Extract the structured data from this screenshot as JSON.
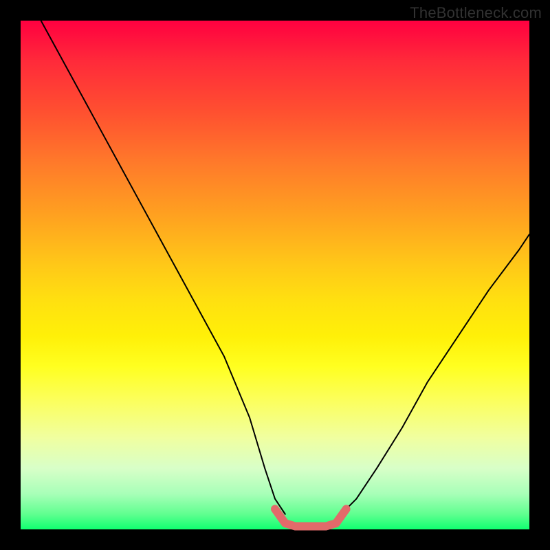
{
  "watermark": "TheBottleneck.com",
  "chart_data": {
    "type": "line",
    "title": "",
    "xlabel": "",
    "ylabel": "",
    "xlim": [
      0,
      100
    ],
    "ylim": [
      0,
      100
    ],
    "grid": false,
    "legend": false,
    "background": "rainbow-gradient-vertical-red-to-green",
    "note": "No axes or tick labels visible; values are relative positions estimated from pixels (0-100 scale).",
    "series": [
      {
        "name": "v-curve-left",
        "stroke": "#000000",
        "stroke_width_px": 2,
        "x": [
          4,
          10,
          16,
          22,
          28,
          34,
          40,
          45,
          48,
          50,
          52
        ],
        "values": [
          100,
          89,
          78,
          67,
          56,
          45,
          34,
          22,
          12,
          6,
          3
        ]
      },
      {
        "name": "v-curve-right",
        "stroke": "#000000",
        "stroke_width_px": 2,
        "x": [
          63,
          66,
          70,
          75,
          80,
          86,
          92,
          98,
          100
        ],
        "values": [
          3,
          6,
          12,
          20,
          29,
          38,
          47,
          55,
          58
        ]
      },
      {
        "name": "bottom-band",
        "stroke": "#e26a6a",
        "stroke_width_px": 12,
        "x": [
          50,
          52,
          54,
          56,
          58,
          60,
          62,
          64
        ],
        "values": [
          4,
          1.2,
          0.6,
          0.6,
          0.6,
          0.6,
          1.2,
          4
        ]
      }
    ]
  }
}
